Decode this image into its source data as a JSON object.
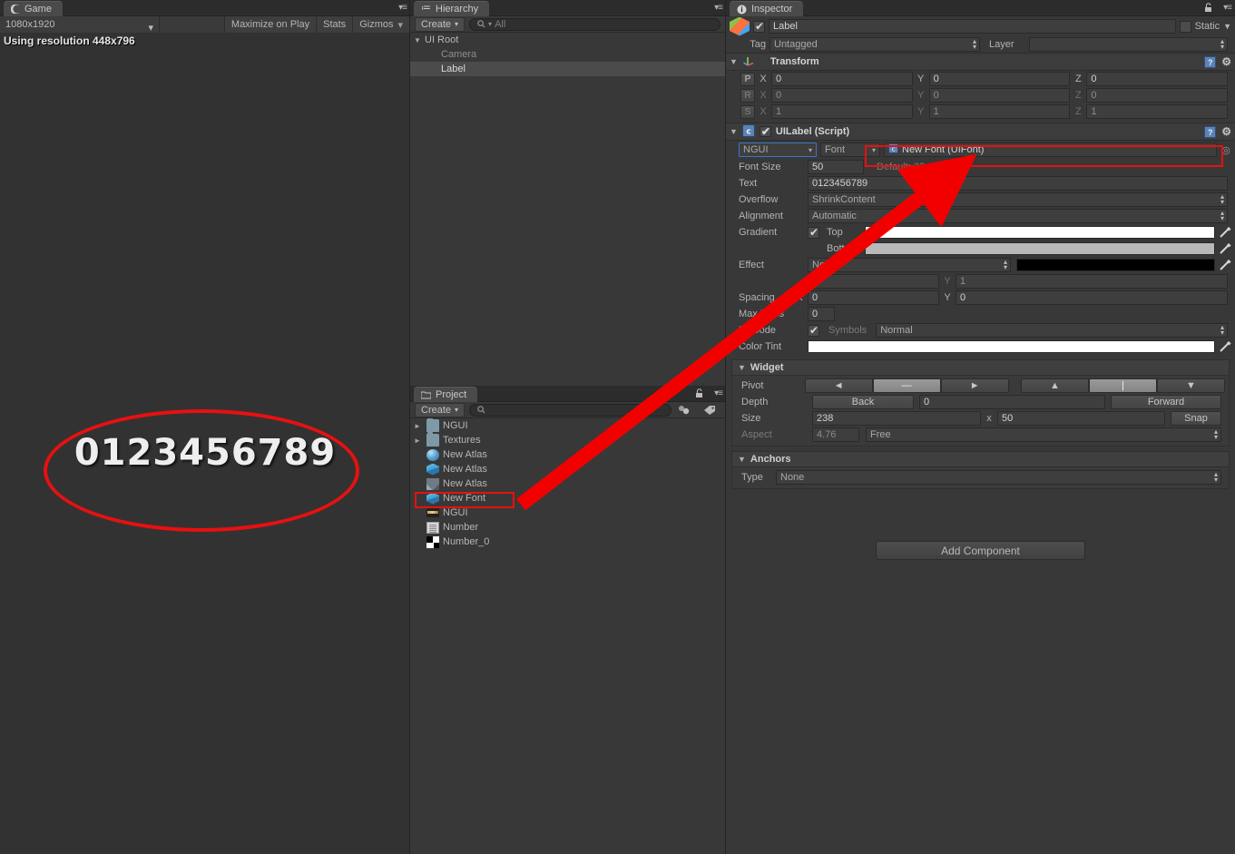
{
  "game": {
    "tab_label": "Game",
    "tab_icon": "game-pacman-icon",
    "resolution_dropdown": "1080x1920",
    "maximize_on_play": "Maximize on Play",
    "stats": "Stats",
    "gizmos": "Gizmos",
    "resolution_text": "Using resolution 448x796",
    "rendered_text": "0123456789",
    "highlight_color": "#e81010"
  },
  "hierarchy": {
    "tab_label": "Hierarchy",
    "create_label": "Create",
    "search_placeholder": "All",
    "items": [
      {
        "label": "UI Root",
        "indent": 0,
        "expanded": true,
        "selected": false,
        "dim": false
      },
      {
        "label": "Camera",
        "indent": 1,
        "expanded": false,
        "selected": false,
        "dim": true
      },
      {
        "label": "Label",
        "indent": 1,
        "expanded": false,
        "selected": true,
        "dim": false
      }
    ]
  },
  "project": {
    "tab_label": "Project",
    "create_label": "Create",
    "search_placeholder": "",
    "items": [
      {
        "label": "NGUI",
        "icon": "folder-icon",
        "tri": true,
        "highlight": false
      },
      {
        "label": "Textures",
        "icon": "folder-icon",
        "tri": true,
        "highlight": false
      },
      {
        "label": "New Atlas",
        "icon": "sphere-material-icon",
        "tri": false,
        "highlight": false
      },
      {
        "label": "New Atlas",
        "icon": "prefab-cube-icon",
        "tri": false,
        "highlight": false
      },
      {
        "label": "New Atlas",
        "icon": "texture-icon",
        "tri": false,
        "highlight": false
      },
      {
        "label": "New Font",
        "icon": "prefab-cube-icon",
        "tri": false,
        "highlight": true
      },
      {
        "label": "NGUI",
        "icon": "ngui-banner-icon",
        "tri": false,
        "highlight": false
      },
      {
        "label": "Number",
        "icon": "text-asset-icon",
        "tri": false,
        "highlight": false
      },
      {
        "label": "Number_0",
        "icon": "png-texture-icon",
        "tri": false,
        "highlight": false
      }
    ]
  },
  "inspector": {
    "tab_label": "Inspector",
    "object_name": "Label",
    "object_enabled": true,
    "static_label": "Static",
    "static_checked": false,
    "tag_label": "Tag",
    "tag_value": "Untagged",
    "layer_label": "Layer",
    "layer_value": "",
    "transform": {
      "title": "Transform",
      "rows": [
        {
          "key": "P",
          "x": "0",
          "y": "0",
          "z": "0",
          "dim": false
        },
        {
          "key": "R",
          "x": "0",
          "y": "0",
          "z": "0",
          "dim": true
        },
        {
          "key": "S",
          "x": "1",
          "y": "1",
          "z": "1",
          "dim": true
        }
      ],
      "axes": [
        "X",
        "Y",
        "Z"
      ]
    },
    "uilabel": {
      "title": "UILabel (Script)",
      "enabled": true,
      "font_source": "NGUI",
      "font_kind": "Font",
      "font_asset": "New Font (UIFont)",
      "font_size_label": "Font Size",
      "font_size": "50",
      "font_size_default": "Default: 32",
      "text_label": "Text",
      "text_value": "0123456789",
      "overflow_label": "Overflow",
      "overflow_value": "ShrinkContent",
      "alignment_label": "Alignment",
      "alignment_value": "Automatic",
      "gradient_label": "Gradient",
      "gradient_checked": true,
      "gradient_top_label": "Top",
      "gradient_top_color": "#ffffff",
      "gradient_bottom_label": "Bottom",
      "gradient_bottom_color": "#b9b9b9",
      "effect_label": "Effect",
      "effect_value": "None",
      "effect_color": "#000000",
      "effect_x": "1",
      "effect_y": "1",
      "spacing_label": "Spacing",
      "spacing_x": "0",
      "spacing_y": "0",
      "max_lines_label": "Max Lines",
      "max_lines": "0",
      "bbcode_label": "BBCode",
      "bbcode_checked": true,
      "symbols_label": "Symbols",
      "symbols_value": "Normal",
      "color_tint_label": "Color Tint",
      "color_tint": "#ffffff",
      "axis_x": "X",
      "axis_y": "Y"
    },
    "widget": {
      "title": "Widget",
      "pivot_label": "Pivot",
      "pivot_h": [
        "◄",
        "—",
        "►"
      ],
      "pivot_h_selected": 1,
      "pivot_v": [
        "▲",
        "|",
        "▼"
      ],
      "pivot_v_selected": 1,
      "depth_label": "Depth",
      "depth_back": "Back",
      "depth_value": "0",
      "depth_forward": "Forward",
      "size_label": "Size",
      "size_w": "238",
      "size_x_sep": "x",
      "size_h": "50",
      "snap_label": "Snap",
      "aspect_label": "Aspect",
      "aspect_value": "4.76",
      "aspect_mode": "Free"
    },
    "anchors": {
      "title": "Anchors",
      "type_label": "Type",
      "type_value": "None"
    },
    "add_component": "Add Component"
  }
}
